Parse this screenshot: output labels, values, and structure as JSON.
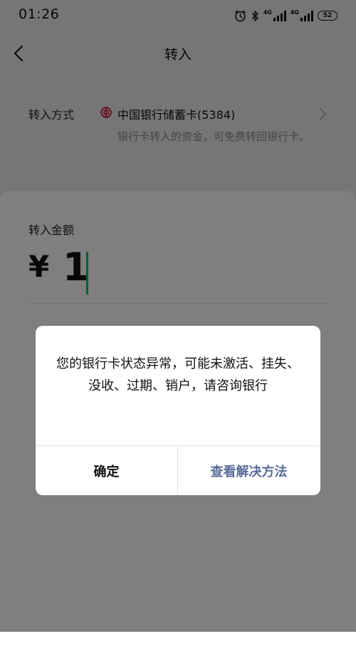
{
  "status_bar": {
    "time": "01:26",
    "network_label_1": "4G",
    "network_label_2": "4G",
    "battery": "52",
    "icons": [
      "alarm-icon",
      "bluetooth-icon",
      "signal-icon",
      "signal-icon",
      "battery-icon"
    ]
  },
  "nav": {
    "title": "转入",
    "back_icon": "chevron-left-icon"
  },
  "method": {
    "label": "转入方式",
    "bank_name": "中国银行储蓄卡(5384)",
    "description": "银行卡转入的资金，可免费转回银行卡。",
    "bank_icon_color": "#c8102e"
  },
  "amount": {
    "label": "转入金额",
    "currency": "¥",
    "value": "1",
    "cursor_color": "#07c160"
  },
  "dialog": {
    "message": "您的银行卡状态异常，可能未激活、挂失、没收、过期、销户，请咨询银行",
    "confirm_label": "确定",
    "solution_label": "查看解决方法",
    "solution_color": "#576b95"
  }
}
